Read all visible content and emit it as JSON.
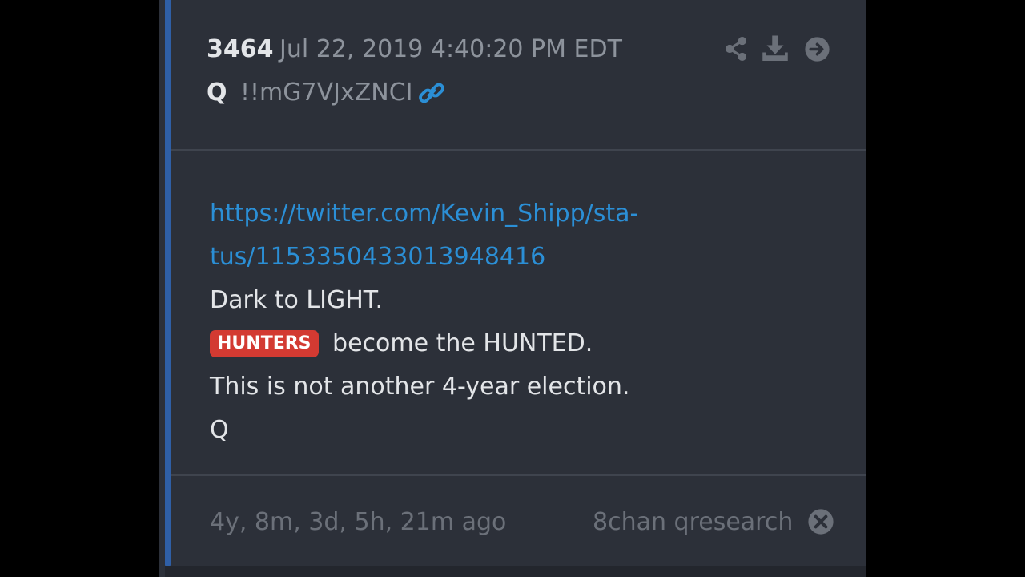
{
  "post": {
    "number": "3464",
    "date": "Jul 22, 2019 4:40:20 PM EDT",
    "author": "Q",
    "tripcode": "!!mG7VJxZNCI"
  },
  "icons": {
    "share": "share-icon",
    "download": "download-icon",
    "next": "arrow-right-circle-icon",
    "link": "link-icon",
    "close": "close-circle-icon"
  },
  "body": {
    "url_line1": "https://twitter.com/Kevin_Shipp/sta-",
    "url_line2": "tus/1153350433013948416",
    "line1": "Dark to LIGHT.",
    "tag": "HUNTERS",
    "line2_rest": " become the HUNTED.",
    "line3": "This is not another 4-year election.",
    "signature": "Q"
  },
  "footer": {
    "time_ago": "4y, 8m, 3d, 5h, 21m ago",
    "source": "8chan qresearch"
  },
  "colors": {
    "background": "#000000",
    "card": "#2c3039",
    "accent": "#2f5fa6",
    "link": "#2b8fd6",
    "tag": "#d33a32",
    "muted_text": "#8d939c",
    "primary_text": "#e3e5e8"
  }
}
